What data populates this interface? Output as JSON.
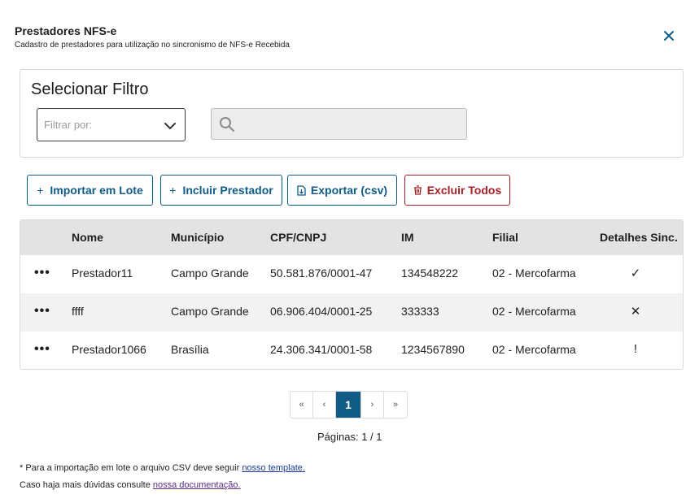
{
  "header": {
    "title": "Prestadores NFS-e",
    "subtitle": "Cadastro de prestadores para utilização no sincronismo de NFS-e Recebida",
    "close_icon": "close-icon"
  },
  "filter": {
    "title": "Selecionar Filtro",
    "select_placeholder": "Filtrar por:",
    "search_value": "",
    "search_icon": "search-icon"
  },
  "toolbar": {
    "import_label": "Importar em Lote",
    "include_label": "Incluir Prestador",
    "export_label": "Exportar (csv)",
    "delete_all_label": "Excluir Todos",
    "accent": "#0f5b86",
    "danger": "#a61f24"
  },
  "table": {
    "columns": [
      "Nome",
      "Município",
      "CPF/CNPJ",
      "IM",
      "Filial",
      "Detalhes Sinc."
    ],
    "rows": [
      {
        "nome": "Prestador11",
        "municipio": "Campo Grande",
        "cnpj": "50.581.876/0001-47",
        "im": "134548222",
        "filial": "02 - Mercofarma",
        "status": "✓",
        "status_icon": "check-icon"
      },
      {
        "nome": "ffff",
        "municipio": "Campo Grande",
        "cnpj": "06.906.404/0001-25",
        "im": "333333",
        "filial": "02 - Mercofarma",
        "status": "✕",
        "status_icon": "x-icon"
      },
      {
        "nome": "Prestador1066",
        "municipio": "Brasília",
        "cnpj": "24.306.341/0001-58",
        "im": "1234567890",
        "filial": "02 - Mercofarma",
        "status": "!",
        "status_icon": "exclamation-icon"
      }
    ],
    "row_menu": "•••"
  },
  "pagination": {
    "first": "«",
    "prev": "‹",
    "current": "1",
    "next": "›",
    "last": "»",
    "pages_text": "Páginas: 1 / 1"
  },
  "notes": {
    "line1_text": "* Para a importação em lote o arquivo CSV deve seguir ",
    "line1_link": "nosso template.",
    "line2_text": "Caso haja mais dúvidas consulte ",
    "line2_link": "nossa documentação."
  }
}
